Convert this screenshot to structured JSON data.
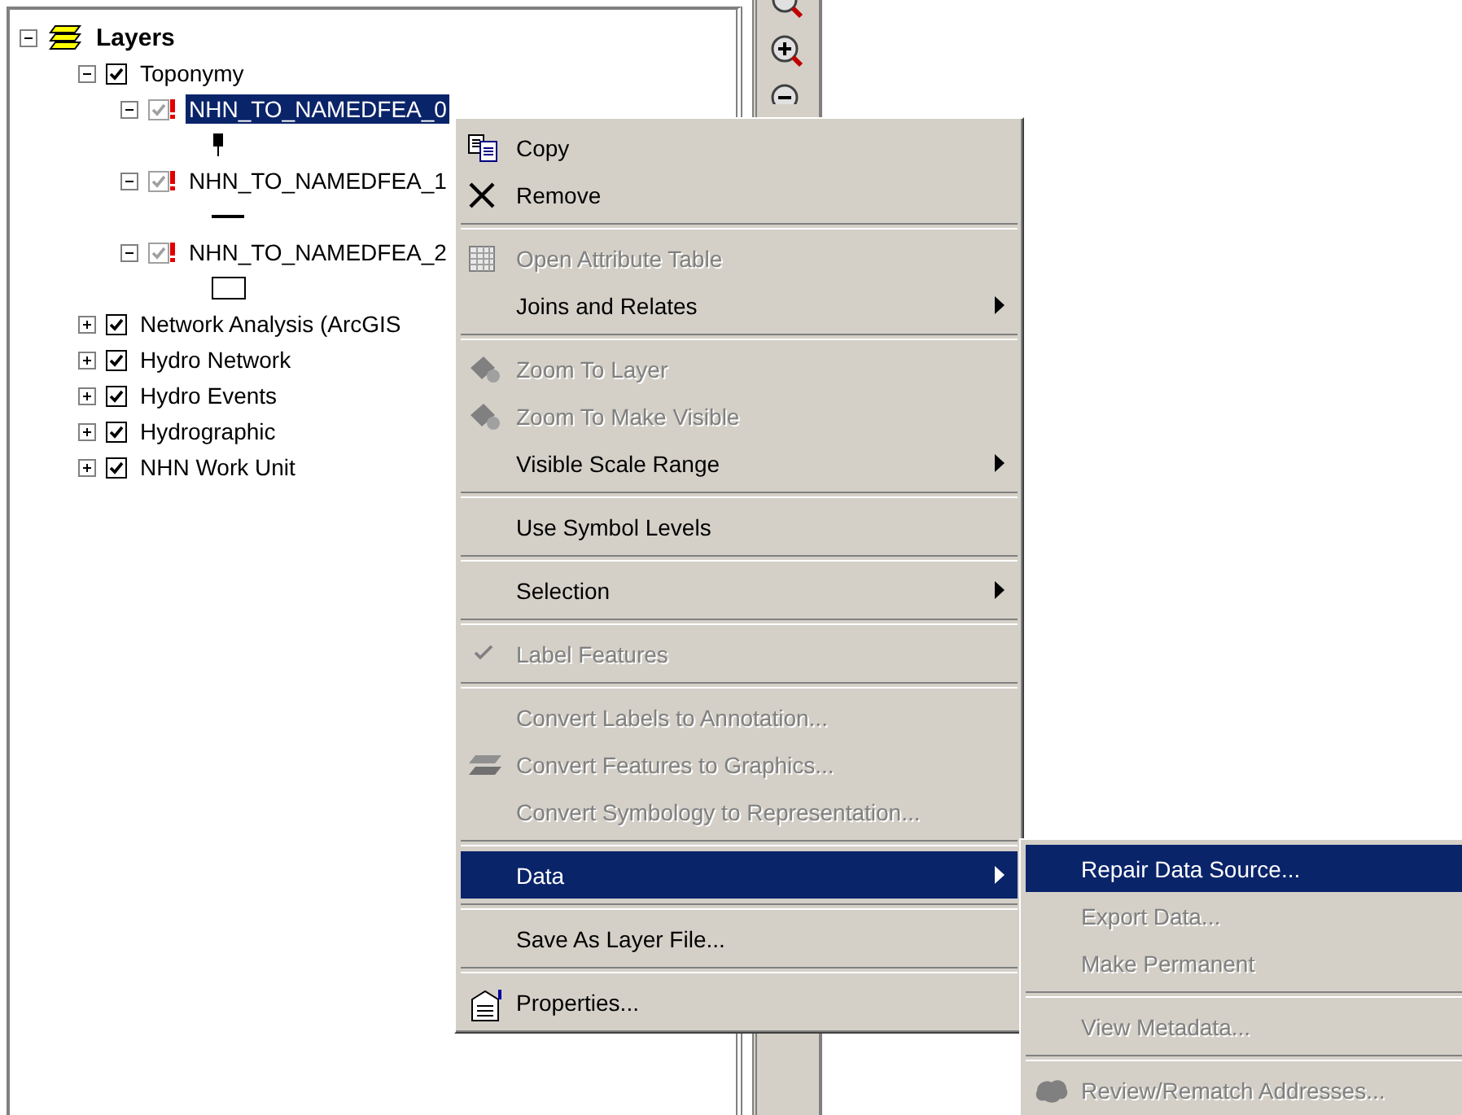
{
  "toc": {
    "title": "Layers",
    "expanded": true,
    "children": [
      {
        "label": "Toponymy",
        "checked": true,
        "expanded": true,
        "children": [
          {
            "label": "NHN_TO_NAMEDFEA_0",
            "checked": true,
            "broken": true,
            "expanded": true,
            "selected": true,
            "symbol": {
              "kind": "point"
            }
          },
          {
            "label": "NHN_TO_NAMEDFEA_1",
            "checked": true,
            "broken": true,
            "expanded": true,
            "selected": false,
            "symbol": {
              "kind": "line"
            }
          },
          {
            "label": "NHN_TO_NAMEDFEA_2",
            "checked": true,
            "broken": true,
            "expanded": true,
            "selected": false,
            "symbol": {
              "kind": "polygon"
            }
          }
        ]
      },
      {
        "label": "Network Analysis (ArcGIS",
        "checked": true,
        "expanded": false
      },
      {
        "label": "Hydro Network",
        "checked": true,
        "expanded": false
      },
      {
        "label": "Hydro Events",
        "checked": true,
        "expanded": false
      },
      {
        "label": "Hydrographic",
        "checked": true,
        "expanded": false
      },
      {
        "label": "NHN Work Unit",
        "checked": true,
        "expanded": false
      }
    ]
  },
  "context_menu": {
    "items": [
      {
        "kind": "copy",
        "label": "Copy",
        "disabled": false,
        "selected": false
      },
      {
        "kind": "remove",
        "label": "Remove",
        "disabled": false,
        "selected": false
      },
      {
        "kind": "separator"
      },
      {
        "kind": "table",
        "label": "Open Attribute Table",
        "disabled": true,
        "selected": false
      },
      {
        "kind": "submenu",
        "label": "Joins and Relates",
        "disabled": false,
        "selected": false
      },
      {
        "kind": "separator"
      },
      {
        "kind": "zoom",
        "label": "Zoom To Layer",
        "disabled": true,
        "selected": false
      },
      {
        "kind": "zoom",
        "label": "Zoom To Make Visible",
        "disabled": true,
        "selected": false
      },
      {
        "kind": "submenu",
        "label": "Visible Scale Range",
        "disabled": false,
        "selected": false
      },
      {
        "kind": "separator"
      },
      {
        "kind": "plain",
        "label": "Use Symbol Levels",
        "disabled": false,
        "selected": false
      },
      {
        "kind": "separator"
      },
      {
        "kind": "submenu",
        "label": "Selection",
        "disabled": false,
        "selected": false
      },
      {
        "kind": "separator"
      },
      {
        "kind": "check",
        "label": "Label Features",
        "disabled": true,
        "selected": false,
        "checked": true
      },
      {
        "kind": "separator"
      },
      {
        "kind": "plain",
        "label": "Convert Labels to Annotation...",
        "disabled": true,
        "selected": false
      },
      {
        "kind": "convert",
        "label": "Convert Features to Graphics...",
        "disabled": true,
        "selected": false
      },
      {
        "kind": "plain",
        "label": "Convert Symbology to Representation...",
        "disabled": true,
        "selected": false
      },
      {
        "kind": "separator"
      },
      {
        "kind": "submenu",
        "label": "Data",
        "disabled": false,
        "selected": true
      },
      {
        "kind": "separator"
      },
      {
        "kind": "plain",
        "label": "Save As Layer File...",
        "disabled": false,
        "selected": false
      },
      {
        "kind": "separator"
      },
      {
        "kind": "properties",
        "label": "Properties...",
        "disabled": false,
        "selected": false
      }
    ]
  },
  "submenu": {
    "items": [
      {
        "kind": "plain",
        "label": "Repair Data Source...",
        "disabled": false,
        "selected": true
      },
      {
        "kind": "plain",
        "label": "Export Data...",
        "disabled": true,
        "selected": false
      },
      {
        "kind": "plain",
        "label": "Make Permanent",
        "disabled": true,
        "selected": false
      },
      {
        "kind": "separator"
      },
      {
        "kind": "plain",
        "label": "View Metadata...",
        "disabled": true,
        "selected": false
      },
      {
        "kind": "separator"
      },
      {
        "kind": "review",
        "label": "Review/Rematch Addresses...",
        "disabled": true,
        "selected": false
      }
    ]
  }
}
